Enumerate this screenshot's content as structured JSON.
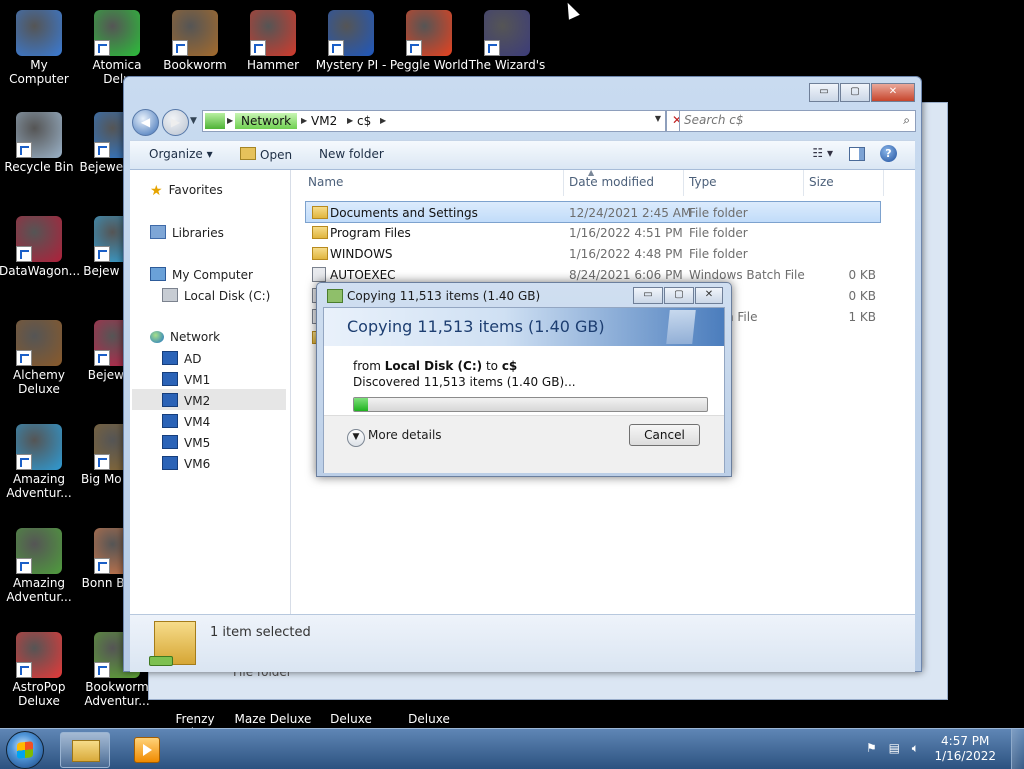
{
  "desktop": {
    "icons": [
      {
        "label": "My Computer",
        "color": "#3a7bd5"
      },
      {
        "label": "Atomica Delu",
        "color": "#2bbf3a"
      },
      {
        "label": "Bookworm",
        "color": "#a56b2c"
      },
      {
        "label": "Hammer",
        "color": "#d33a2c"
      },
      {
        "label": "Mystery PI -",
        "color": "#1e58c0"
      },
      {
        "label": "Peggle World",
        "color": "#e8421f"
      },
      {
        "label": "The Wizard's",
        "color": "#3c3c7a"
      },
      {
        "label": "Recycle Bin",
        "color": "#9bb3c9"
      },
      {
        "label": "Bejewe Delu",
        "color": "#2d7cd6"
      },
      {
        "label": "DataWagon...",
        "color": "#b0203a"
      },
      {
        "label": "Bejew Delu",
        "color": "#33a9e0"
      },
      {
        "label": "Alchemy Deluxe",
        "color": "#8a5a2a"
      },
      {
        "label": "Bejew Twi",
        "color": "#c8214a"
      },
      {
        "label": "Amazing Adventur...",
        "color": "#2e9bd4"
      },
      {
        "label": "Big Mo Delu",
        "color": "#8b6a33"
      },
      {
        "label": "Amazing Adventur...",
        "color": "#4f9d3d"
      },
      {
        "label": "Bonn Books",
        "color": "#d77a4a"
      },
      {
        "label": "AstroPop Deluxe",
        "color": "#e63939"
      },
      {
        "label": "Bookworm Adventur...",
        "color": "#5faa34"
      },
      {
        "label": "Frenzy Deluxe",
        "color": "#000000"
      },
      {
        "label": "Maze Deluxe",
        "color": "#000000"
      },
      {
        "label": "Deluxe",
        "color": "#000000"
      },
      {
        "label": "Deluxe",
        "color": "#000000"
      }
    ]
  },
  "explorer": {
    "caption_buttons": {
      "minimize": "▭",
      "maximize": "▢",
      "close": "✕"
    },
    "address": {
      "crumbs": [
        "Network",
        "VM2",
        "c$"
      ]
    },
    "search": {
      "placeholder": "Search c$"
    },
    "toolbar": {
      "organize": "Organize ▾",
      "open": "Open",
      "new_folder": "New folder"
    },
    "nav": {
      "favorites": "Favorites",
      "libraries": "Libraries",
      "my_computer": "My Computer",
      "local_disk": "Local Disk (C:)",
      "network": "Network",
      "machines": [
        "AD",
        "VM1",
        "VM2",
        "VM4",
        "VM5",
        "VM6"
      ]
    },
    "columns": {
      "name": "Name",
      "date": "Date modified",
      "type": "Type",
      "size": "Size"
    },
    "files": [
      {
        "name": "Documents and Settings",
        "date": "12/24/2021 2:45 AM",
        "type": "File folder",
        "size": ""
      },
      {
        "name": "Program Files",
        "date": "1/16/2022 4:51 PM",
        "type": "File folder",
        "size": ""
      },
      {
        "name": "WINDOWS",
        "date": "1/16/2022 4:48 PM",
        "type": "File folder",
        "size": ""
      },
      {
        "name": "AUTOEXEC",
        "date": "8/24/2021 6:06 PM",
        "type": "Windows Batch File",
        "size": "0 KB"
      },
      {
        "name": "",
        "date": "",
        "type": "ile",
        "size": "0 KB"
      },
      {
        "name": "",
        "date": "",
        "type": "s Batch File",
        "size": "1 KB"
      },
      {
        "name": "",
        "date": "",
        "type": "er",
        "size": ""
      }
    ],
    "status": "1 item selected"
  },
  "background_window": {
    "peek_text": "File folder"
  },
  "copy_dialog": {
    "title": "Copying 11,513 items (1.40 GB)",
    "heading": "Copying 11,513 items (1.40 GB)",
    "from_prefix": "from",
    "from_src": "Local Disk (C:)",
    "from_mid": "to",
    "from_dst": "c$",
    "discovered": "Discovered 11,513 items (1.40 GB)...",
    "progress_percent": 4,
    "more_details": "More details",
    "cancel": "Cancel"
  },
  "taskbar": {
    "time": "4:57 PM",
    "date": "1/16/2022"
  }
}
